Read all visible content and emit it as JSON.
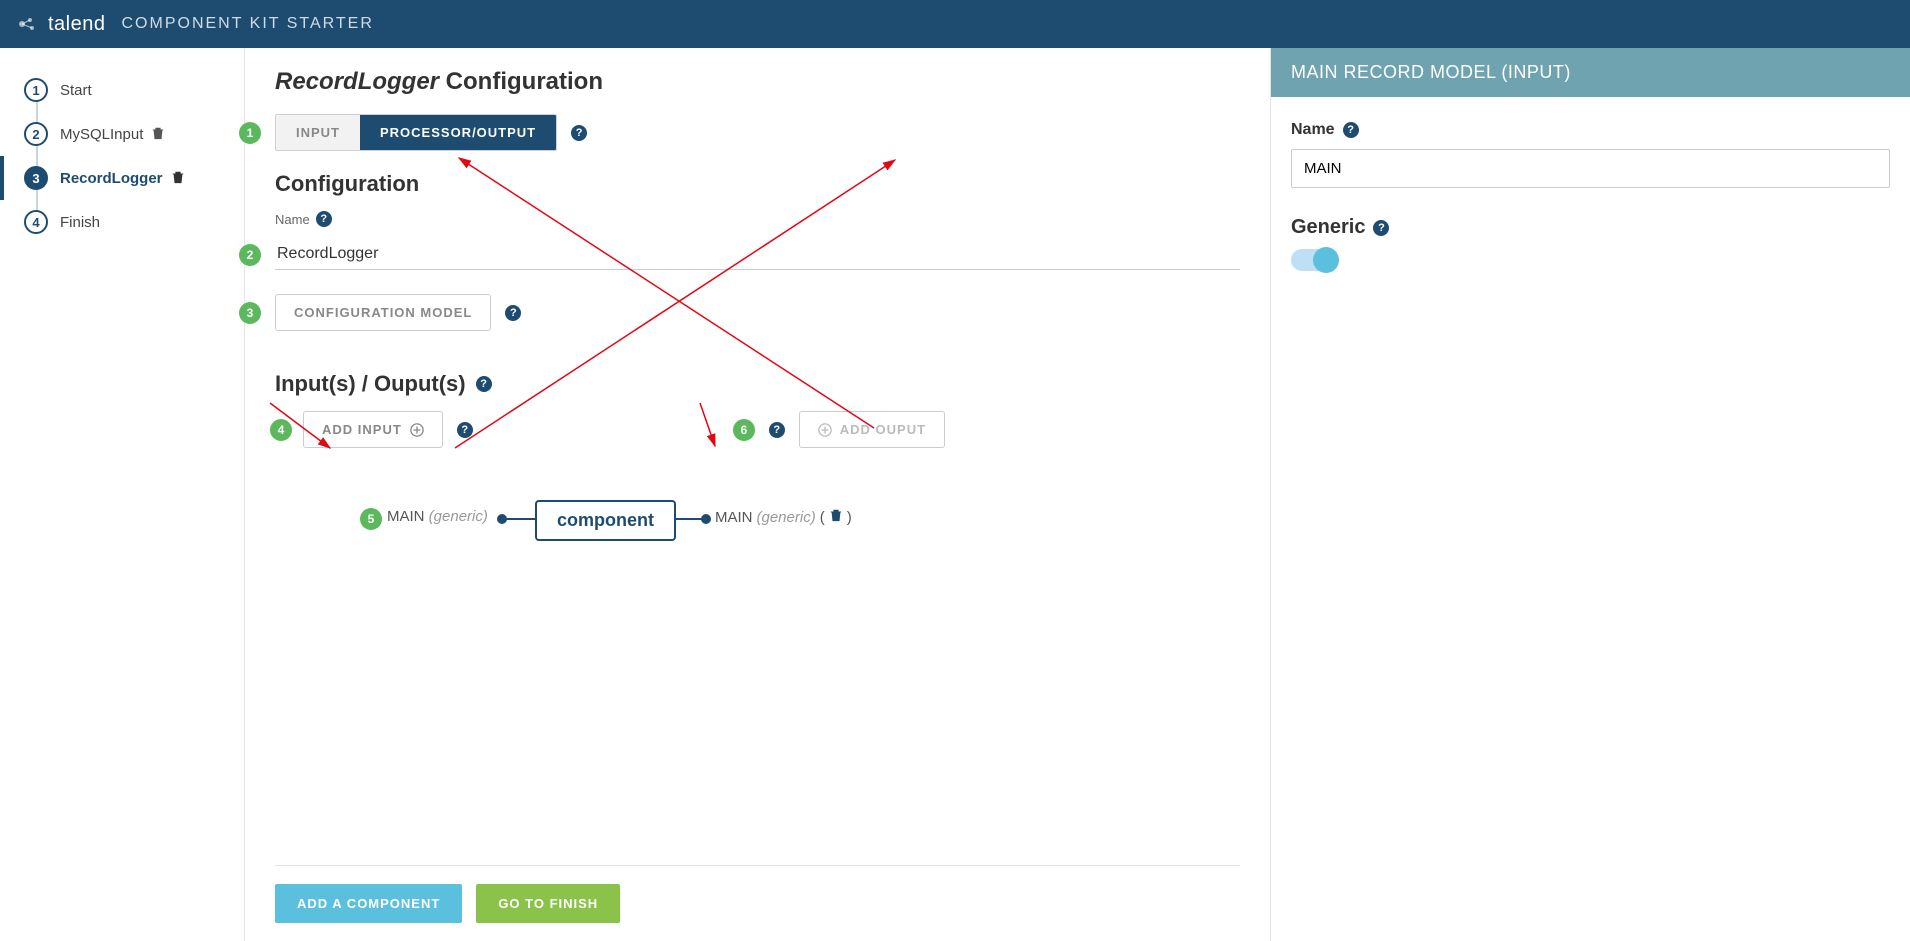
{
  "header": {
    "brand": "talend",
    "subtitle": "COMPONENT KIT STARTER"
  },
  "sidebar": {
    "steps": [
      {
        "num": "1",
        "label": "Start",
        "trash": false,
        "active": false
      },
      {
        "num": "2",
        "label": "MySQLInput",
        "trash": true,
        "active": false
      },
      {
        "num": "3",
        "label": "RecordLogger",
        "trash": true,
        "active": true
      },
      {
        "num": "4",
        "label": "Finish",
        "trash": false,
        "active": false
      }
    ]
  },
  "main": {
    "title_component": "RecordLogger",
    "title_suffix": " Configuration",
    "type_toggle": {
      "input": "INPUT",
      "processor": "PROCESSOR/OUTPUT"
    },
    "config_section": "Configuration",
    "name_label": "Name",
    "name_value": "RecordLogger",
    "config_model_btn": "CONFIGURATION MODEL",
    "io_section": "Input(s) / Ouput(s)",
    "add_input_btn": "ADD INPUT",
    "add_output_btn": "ADD OUPUT",
    "diagram": {
      "input_name": "MAIN",
      "input_generic": "(generic)",
      "box_label": "component",
      "output_name": "MAIN",
      "output_generic": "(generic)"
    },
    "badges": {
      "b1": "1",
      "b2": "2",
      "b3": "3",
      "b4": "4",
      "b5": "5",
      "b6": "6"
    },
    "footer": {
      "add_component": "ADD A COMPONENT",
      "go_finish": "GO TO FINISH"
    }
  },
  "panel": {
    "title": "MAIN RECORD MODEL (INPUT)",
    "name_label": "Name",
    "name_value": "MAIN",
    "generic_label": "Generic"
  }
}
